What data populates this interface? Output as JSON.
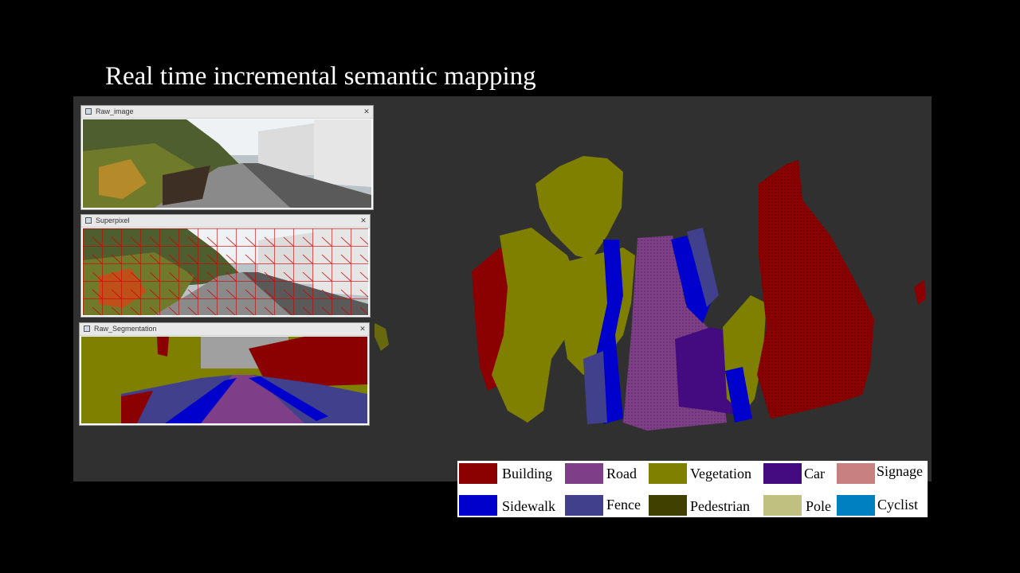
{
  "slide": {
    "title": "Real time incremental semantic mapping"
  },
  "windows": {
    "raw_image": {
      "title": "Raw_image"
    },
    "superpixel": {
      "title": "Superpixel"
    },
    "raw_segmentation": {
      "title": "Raw_Segmentation"
    }
  },
  "legend": {
    "items": [
      {
        "label": "Building",
        "color": "#8b0000"
      },
      {
        "label": "Road",
        "color": "#7f3f88"
      },
      {
        "label": "Vegetation",
        "color": "#808000"
      },
      {
        "label": "Car",
        "color": "#440a80"
      },
      {
        "label": "Signage",
        "color": "#c88080"
      },
      {
        "label": "Sidewalk",
        "color": "#0000cc"
      },
      {
        "label": "Fence",
        "color": "#40408c"
      },
      {
        "label": "Pedestrian",
        "color": "#404000"
      },
      {
        "label": "Pole",
        "color": "#c0c080"
      },
      {
        "label": "Cyclist",
        "color": "#0080c0"
      }
    ]
  }
}
